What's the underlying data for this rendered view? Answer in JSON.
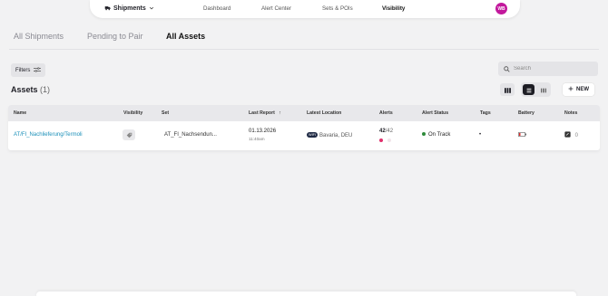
{
  "nav": {
    "dropdown_label": "Shipments",
    "links": [
      "Dashboard",
      "Alert Center",
      "Sets & POIs",
      "Visibility"
    ],
    "active_link": "Visibility",
    "avatar_initials": "WB",
    "avatar_color": "#c2189c"
  },
  "tabs": [
    "All Shipments",
    "Pending to Pair",
    "All Assets"
  ],
  "active_tab": "All Assets",
  "toolbar": {
    "filters_label": "Filters",
    "search_placeholder": "Search",
    "new_label": "NEW"
  },
  "assets": {
    "title": "Assets",
    "count": "(1)"
  },
  "table": {
    "headers": [
      "Name",
      "Visibility",
      "Set",
      "Last Report",
      "Latest Location",
      "Alerts",
      "Alert Status",
      "Tags",
      "Battery",
      "Notes"
    ],
    "sort_indicator": "↑",
    "rows": [
      {
        "name": "AT/FI_Nachlieferung/Termoli",
        "set": "AT_FI_Nachsendun...",
        "last_report_date": "01.13.2026",
        "last_report_time": "11:40am",
        "location_badge": "WIFI",
        "location": "Bavaria, DEU",
        "alerts_count": "42",
        "alerts_total": "/42",
        "alert_status": "On Track",
        "tags": "•",
        "notes_count": "0"
      }
    ]
  },
  "colors": {
    "link": "#1a8fb8",
    "on_track": "#2e8b3a",
    "alert_dot": "#e0306c",
    "battery_low": "#e02b2b"
  }
}
